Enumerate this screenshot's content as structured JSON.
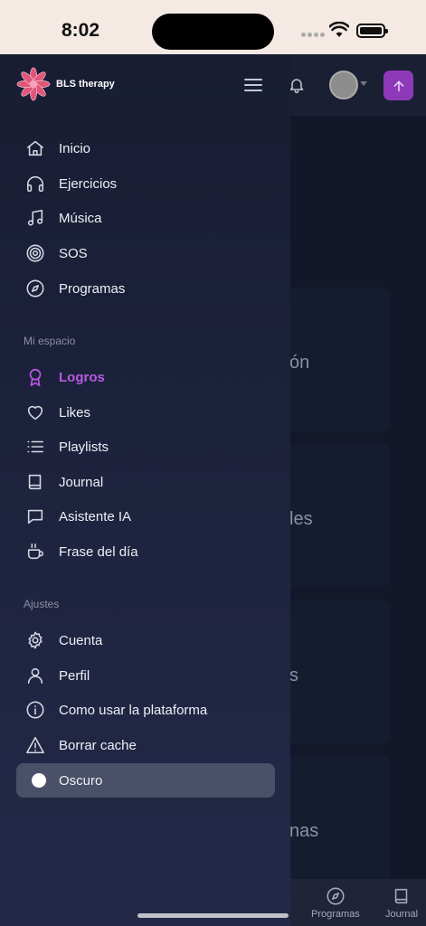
{
  "status_bar": {
    "time": "8:02"
  },
  "brand": {
    "name": "BLS therapy",
    "accent": "#e0567a"
  },
  "menu": {
    "main": [
      {
        "label": "Inicio",
        "icon": "home-icon"
      },
      {
        "label": "Ejercicios",
        "icon": "headphones-icon"
      },
      {
        "label": "Música",
        "icon": "music-note-icon"
      },
      {
        "label": "SOS",
        "icon": "target-icon"
      },
      {
        "label": "Programas",
        "icon": "compass-icon"
      }
    ],
    "section_my_space": "Mi espacio",
    "my_space": [
      {
        "label": "Logros",
        "icon": "award-icon",
        "active": true
      },
      {
        "label": "Likes",
        "icon": "heart-icon"
      },
      {
        "label": "Playlists",
        "icon": "list-icon"
      },
      {
        "label": "Journal",
        "icon": "book-icon"
      },
      {
        "label": "Asistente IA",
        "icon": "chat-icon"
      },
      {
        "label": "Frase del día",
        "icon": "coffee-cup-icon"
      }
    ],
    "section_settings": "Ajustes",
    "settings": [
      {
        "label": "Cuenta",
        "icon": "gear-icon"
      },
      {
        "label": "Perfil",
        "icon": "user-icon"
      },
      {
        "label": "Como usar la plataforma",
        "icon": "info-icon"
      },
      {
        "label": "Borrar cache",
        "icon": "warning-icon"
      }
    ],
    "theme_toggle": {
      "label": "Oscuro",
      "on": true
    }
  },
  "background": {
    "card_texts": [
      "ón",
      "les",
      "s",
      "nas"
    ],
    "bottom_nav": [
      {
        "label": "Programas",
        "icon": "compass-icon"
      },
      {
        "label": "Journal",
        "icon": "book-icon"
      }
    ]
  },
  "colors": {
    "active": "#b75be0",
    "upload_button": "#8e3ab8"
  }
}
